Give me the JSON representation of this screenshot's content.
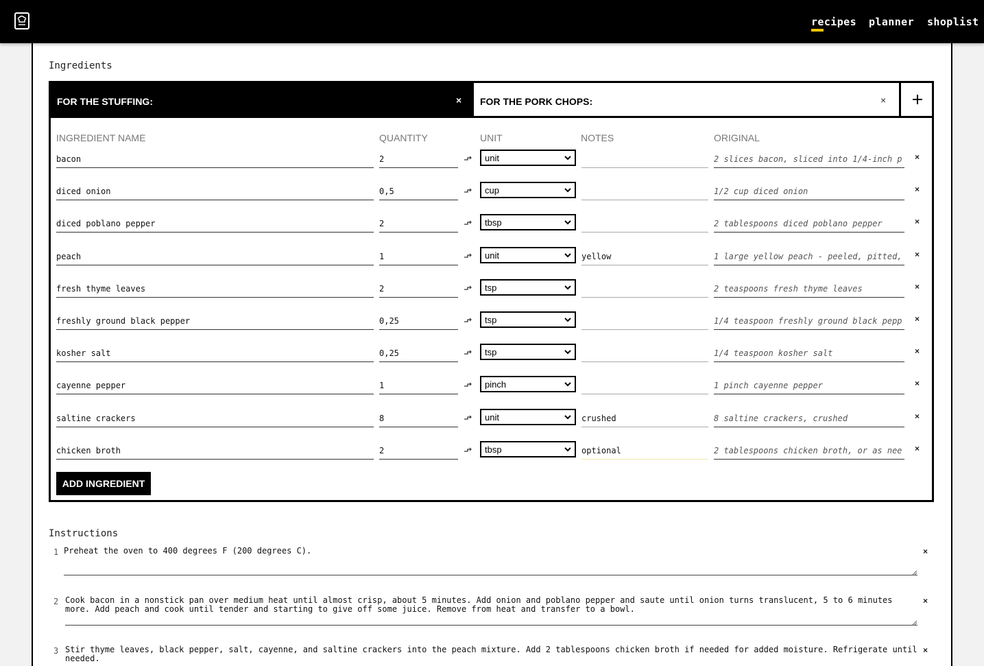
{
  "nav": {
    "logo_icon": "chef-hat-book-icon",
    "items": [
      "recipes",
      "planner",
      "shoplist"
    ],
    "active": "recipes",
    "accent_color": "#f5c400"
  },
  "ingredients": {
    "title": "Ingredients",
    "tabs": [
      {
        "label": "FOR THE STUFFING:",
        "close": "×",
        "active": true
      },
      {
        "label": "FOR THE PORK CHOPS:",
        "close": "×",
        "active": false
      }
    ],
    "add_tab_icon": "plus-icon",
    "columns": {
      "name": "INGREDIENT NAME",
      "quantity": "QUANTITY",
      "unit": "UNIT",
      "notes": "NOTES",
      "original": "ORIGINAL"
    },
    "rows": [
      {
        "name": "bacon",
        "quantity": "2",
        "unit": "unit",
        "notes": "",
        "original": "2 slices bacon, sliced into 1/4-inch p"
      },
      {
        "name": "diced onion",
        "quantity": "0,5",
        "unit": "cup",
        "notes": "",
        "original": "1/2 cup diced onion"
      },
      {
        "name": "diced poblano pepper",
        "quantity": "2",
        "unit": "tbsp",
        "notes": "",
        "original": "2 tablespoons diced poblano pepper"
      },
      {
        "name": "peach",
        "quantity": "1",
        "unit": "unit",
        "notes": "yellow",
        "original": "1 large yellow peach - peeled, pitted,"
      },
      {
        "name": "fresh thyme leaves",
        "quantity": "2",
        "unit": "tsp",
        "notes": "",
        "original": "2 teaspoons fresh thyme leaves"
      },
      {
        "name": "freshly ground black pepper",
        "quantity": "0,25",
        "unit": "tsp",
        "notes": "",
        "original": "1/4 teaspoon freshly ground black pepp"
      },
      {
        "name": "kosher salt",
        "quantity": "0,25",
        "unit": "tsp",
        "notes": "",
        "original": "1/4 teaspoon kosher salt"
      },
      {
        "name": "cayenne pepper",
        "quantity": "1",
        "unit": "pinch",
        "notes": "",
        "original": "1 pinch cayenne pepper"
      },
      {
        "name": "saltine crackers",
        "quantity": "8",
        "unit": "unit",
        "notes": "crushed",
        "original": "8 saltine crackers, crushed"
      },
      {
        "name": "chicken broth",
        "quantity": "2",
        "unit": "tbsp",
        "notes": "optional",
        "original": "2 tablespoons chicken broth, or as nee"
      }
    ],
    "row_delete": "×",
    "add_button": "ADD INGREDIENT"
  },
  "instructions": {
    "title": "Instructions",
    "delete": "×",
    "steps": [
      {
        "num": "1",
        "text": "Preheat the oven to 400 degrees F (200 degrees C)."
      },
      {
        "num": "2",
        "text": "Cook bacon in a nonstick pan over medium heat until almost crisp, about 5 minutes. Add onion and poblano pepper and saute until onion turns translucent, 5 to 6 minutes more. Add peach and cook until tender and starting to give off some juice. Remove from heat and transfer to a bowl."
      },
      {
        "num": "3",
        "text": "Stir thyme leaves, black pepper, salt, cayenne, and saltine crackers into the peach mixture. Add 2 tablespoons chicken broth if needed for added moisture. Refrigerate until needed."
      }
    ]
  }
}
